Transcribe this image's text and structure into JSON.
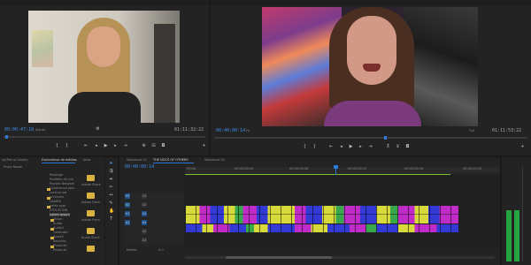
{
  "source_monitor": {
    "timecode": "00:00:47:18",
    "zoom": "Adjust",
    "duration": "01:11:32:22"
  },
  "program_monitor": {
    "timecode": "00:40:00:14",
    "zoom": "Fit",
    "quality": "Full",
    "duration": "01:11:53:22"
  },
  "project_panel": {
    "title_left": "ng Pan e/ Library",
    "tab_active": "Explorateur de médias",
    "tab_info": "Infos",
    "tab_bookmarks": "Bookmarks",
    "column_header": "Proxy Name",
    "tree_items": [
      "Prolonge",
      "Portfolio for pro",
      "Proxies Network",
      "Commence Jaun",
      "Lecture vol",
      "Archivers",
      "Listofte",
      "white spot",
      "STOLID DIN",
      "Lorem Ipsum",
      "Alison",
      "Audio",
      "Audio1",
      "Gerondes",
      "Stock2",
      "Raccolts",
      "Photo de",
      "Photo de"
    ],
    "bins": [
      "Adobe Stock",
      "Adobe From",
      "Adobe From",
      "Audio Stock"
    ]
  },
  "timeline": {
    "sequence_tab": "Sequence 01",
    "active_tab": "THE DOCS OF OTHERS",
    "extra_tab": "Sequence 02",
    "timecode": "00:40:00:14",
    "ruler_labels": [
      "00:00",
      "00:40:00:04",
      "00:40:00:08",
      "00:40:00:12",
      "00:40:00:16",
      "00:40:00:20"
    ],
    "tracks": [
      "V3",
      "V2",
      "V1",
      "A1",
      "A2",
      "A3"
    ],
    "master_label": "Master",
    "master_value": "0.0"
  },
  "colors": {
    "accent": "#2d7ad6",
    "timecode": "#3d8ee8",
    "clip_yellow": "#d8d93a",
    "clip_magenta": "#c02cc8",
    "clip_blue": "#3339d4",
    "clip_green": "#39a84c",
    "meter": "#26a341"
  }
}
